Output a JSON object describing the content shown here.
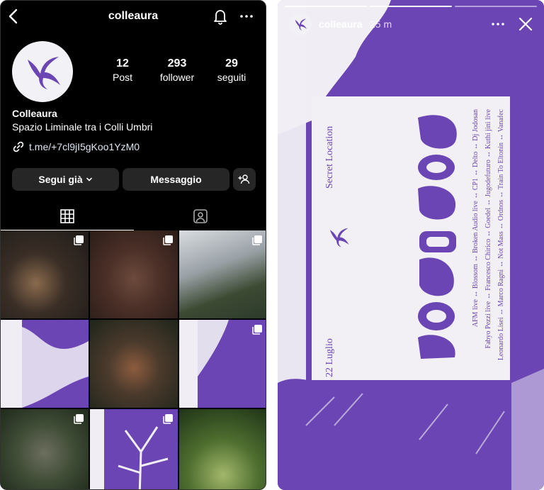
{
  "colors": {
    "accent": "#6b45b3",
    "background": "#000000",
    "poster": "#f2f0f5"
  },
  "profile": {
    "username": "colleaura",
    "display_name": "Colleaura",
    "bio": "Spazio Liminale tra i Colli Umbri",
    "link": "t.me/+7cl9jI5gKoo1YzM0",
    "stats": [
      {
        "value": "12",
        "label": "Post"
      },
      {
        "value": "293",
        "label": "follower"
      },
      {
        "value": "29",
        "label": "seguiti"
      }
    ],
    "buttons": {
      "follow": "Segui già",
      "message": "Messaggio"
    },
    "icons": {
      "back": "back-arrow-icon",
      "bell": "bell-icon",
      "more": "more-icon",
      "link": "link-icon",
      "add_user": "add-user-icon",
      "grid": "grid-icon",
      "tagged": "tagged-icon",
      "multi": "multi-post-icon"
    }
  },
  "story": {
    "username": "colleaura",
    "time": "25 m",
    "poster": {
      "location": "Secret Location",
      "date": "22 Luglio",
      "lineup": [
        "AFM live ↔ Blossom ↔ Broken Audio live ↔ CP1 ↔ Delto ↔ Dj Jodosan",
        "Fabyo Pezzi live ↔ Francesco Chirico ↔ Goedel ↔ Jugodefuturo ↔ Kuthi jini live",
        "Leonardo Lisei ↔ Marco Ragni ↔ Not Mass ↔ Ordnos ↔ Train To Eltonin ↔ Vanafec"
      ]
    }
  }
}
